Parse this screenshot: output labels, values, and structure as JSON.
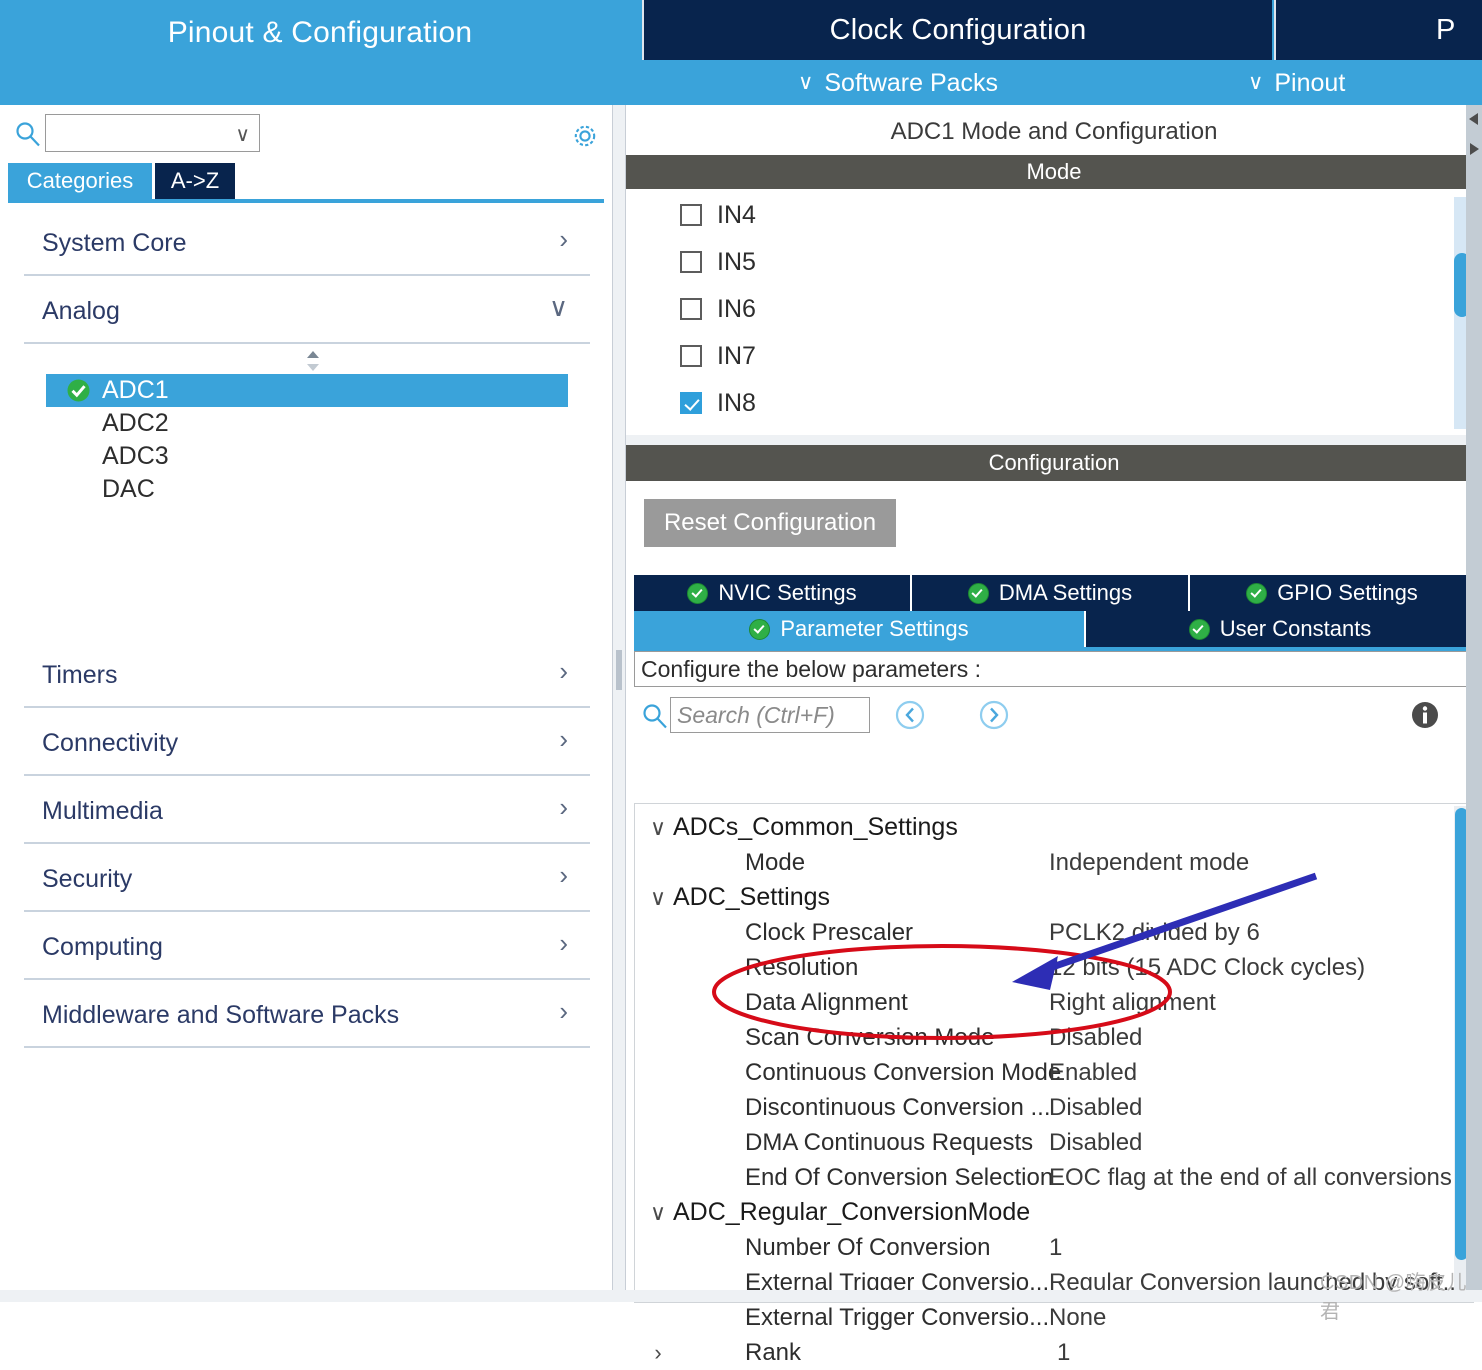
{
  "tabs": {
    "pinout_configuration": "Pinout & Configuration",
    "clock_configuration": "Clock Configuration",
    "project_manager_partial": "P"
  },
  "subtabs": {
    "software_packs": "Software Packs",
    "pinout": "Pinout",
    "chevron": "∨"
  },
  "left_panel": {
    "search": {
      "value": "",
      "placeholder": ""
    },
    "gear_tooltip": "",
    "category_tabs": [
      {
        "label": "Categories",
        "selected": true
      },
      {
        "label": "A->Z",
        "selected": false
      }
    ],
    "groups": [
      {
        "label": "System Core",
        "expanded": false,
        "chevron": "›"
      },
      {
        "label": "Analog",
        "expanded": true,
        "chevron": "∨"
      },
      {
        "label": "Timers",
        "expanded": false,
        "chevron": "›"
      },
      {
        "label": "Connectivity",
        "expanded": false,
        "chevron": "›"
      },
      {
        "label": "Multimedia",
        "expanded": false,
        "chevron": "›"
      },
      {
        "label": "Security",
        "expanded": false,
        "chevron": "›"
      },
      {
        "label": "Computing",
        "expanded": false,
        "chevron": "›"
      },
      {
        "label": "Middleware and Software Packs",
        "expanded": false,
        "chevron": "›"
      }
    ],
    "analog_items": [
      {
        "label": "ADC1",
        "selected": true,
        "configured": true
      },
      {
        "label": "ADC2",
        "selected": false,
        "configured": false
      },
      {
        "label": "ADC3",
        "selected": false,
        "configured": false
      },
      {
        "label": "DAC",
        "selected": false,
        "configured": false
      }
    ]
  },
  "right_panel": {
    "title": "ADC1 Mode and Configuration",
    "mode_band": "Mode",
    "mode_inputs": [
      {
        "label": "IN4",
        "checked": false
      },
      {
        "label": "IN5",
        "checked": false
      },
      {
        "label": "IN6",
        "checked": false
      },
      {
        "label": "IN7",
        "checked": false
      },
      {
        "label": "IN8",
        "checked": true
      }
    ],
    "configuration_band": "Configuration",
    "reset_button": "Reset Configuration",
    "config_tabs_row1": [
      {
        "label": "NVIC Settings",
        "selected": false
      },
      {
        "label": "DMA Settings",
        "selected": false
      },
      {
        "label": "GPIO Settings",
        "selected": false
      }
    ],
    "config_tabs_row2": [
      {
        "label": "Parameter Settings",
        "selected": true
      },
      {
        "label": "User Constants",
        "selected": false
      }
    ],
    "configure_note": "Configure the below parameters :",
    "param_search_placeholder": "Search (Ctrl+F)",
    "param_search_value": "",
    "nav_prev_icon": "chevron-left-circle-icon",
    "nav_next_icon": "chevron-right-circle-icon",
    "info_icon": "info-icon",
    "parameters": [
      {
        "type": "group",
        "chevron": "∨",
        "name": "ADCs_Common_Settings",
        "value": ""
      },
      {
        "type": "item",
        "chevron": "",
        "name": "Mode",
        "value": "Independent mode"
      },
      {
        "type": "group",
        "chevron": "∨",
        "name": "ADC_Settings",
        "value": ""
      },
      {
        "type": "item",
        "chevron": "",
        "name": "Clock Prescaler",
        "value": "PCLK2 divided by 6"
      },
      {
        "type": "item",
        "chevron": "",
        "name": "Resolution",
        "value": "12 bits (15 ADC Clock cycles)"
      },
      {
        "type": "item",
        "chevron": "",
        "name": "Data Alignment",
        "value": "Right alignment"
      },
      {
        "type": "item",
        "chevron": "",
        "name": "Scan Conversion Mode",
        "value": "Disabled"
      },
      {
        "type": "item",
        "chevron": "",
        "name": "Continuous Conversion Mode",
        "value": "Enabled"
      },
      {
        "type": "item",
        "chevron": "",
        "name": "Discontinuous Conversion ...",
        "value": "Disabled"
      },
      {
        "type": "item",
        "chevron": "",
        "name": "DMA Continuous Requests",
        "value": "Disabled"
      },
      {
        "type": "item",
        "chevron": "",
        "name": "End Of Conversion Selection",
        "value": "EOC flag at the end of all conversions"
      },
      {
        "type": "group",
        "chevron": "∨",
        "name": "ADC_Regular_ConversionMode",
        "value": ""
      },
      {
        "type": "item",
        "chevron": "",
        "name": "Number Of Conversion",
        "value": "1"
      },
      {
        "type": "item",
        "chevron": "",
        "name": "External Trigger Conversio...",
        "value": "Regular Conversion launched by soft..."
      },
      {
        "type": "item",
        "chevron": "",
        "name": "External Trigger Conversio...",
        "value": "None"
      },
      {
        "type": "item",
        "chevron": "›",
        "name": "Rank",
        "value": "1"
      }
    ]
  },
  "annotations": {
    "ellipse_color": "#d60b18",
    "arrow_color": "#2d2db5",
    "highlighted_row": "Continuous Conversion Mode"
  },
  "watermark": "CSDN @嗨皮儿君",
  "colors": {
    "accent_blue": "#3aa3da",
    "navy": "#08244d",
    "gray_band": "#54544f",
    "green_ok": "#2faf46",
    "button_gray": "#9a9a9a"
  }
}
